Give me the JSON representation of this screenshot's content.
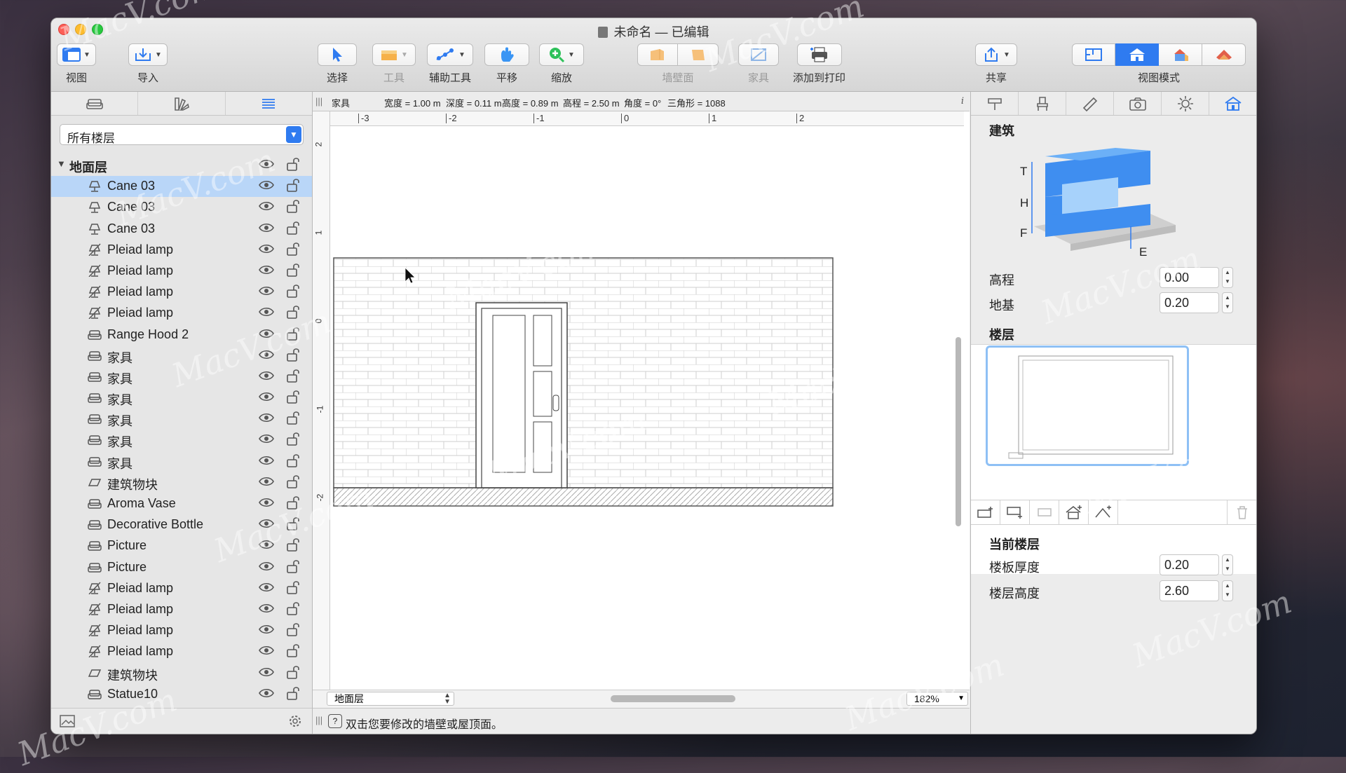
{
  "window": {
    "title": "未命名 — 已编辑"
  },
  "toolbar": {
    "view_label": "视图",
    "import_label": "导入",
    "select_label": "选择",
    "tools_label": "工具",
    "helper_tools_label": "辅助工具",
    "pan_label": "平移",
    "zoom_label": "缩放",
    "wall_surface_label": "墙壁面",
    "furniture_label": "家具",
    "add_to_print_label": "添加到打印",
    "share_label": "共享",
    "view_mode_label": "视图模式"
  },
  "left_panel": {
    "floor_filter": "所有楼层",
    "group": {
      "name": "地面层"
    },
    "items": [
      {
        "name": "Cane 03",
        "icon": "lamp-icon",
        "selected": true
      },
      {
        "name": "Cane 03",
        "icon": "lamp-icon",
        "selected": false
      },
      {
        "name": "Cane 03",
        "icon": "lamp-icon",
        "selected": false
      },
      {
        "name": "Pleiad lamp",
        "icon": "lamp-hidden-icon",
        "selected": false
      },
      {
        "name": "Pleiad lamp",
        "icon": "lamp-hidden-icon",
        "selected": false
      },
      {
        "name": "Pleiad lamp",
        "icon": "lamp-hidden-icon",
        "selected": false
      },
      {
        "name": "Pleiad lamp",
        "icon": "lamp-hidden-icon",
        "selected": false
      },
      {
        "name": "Range Hood 2",
        "icon": "furniture-icon",
        "selected": false
      },
      {
        "name": "家具",
        "icon": "furniture-icon",
        "selected": false
      },
      {
        "name": "家具",
        "icon": "furniture-icon",
        "selected": false
      },
      {
        "name": "家具",
        "icon": "furniture-icon",
        "selected": false
      },
      {
        "name": "家具",
        "icon": "furniture-icon",
        "selected": false
      },
      {
        "name": "家具",
        "icon": "furniture-icon",
        "selected": false
      },
      {
        "name": "家具",
        "icon": "furniture-icon",
        "selected": false
      },
      {
        "name": "建筑物块",
        "icon": "block-icon",
        "selected": false
      },
      {
        "name": "Aroma Vase",
        "icon": "furniture-icon",
        "selected": false
      },
      {
        "name": "Decorative Bottle",
        "icon": "furniture-icon",
        "selected": false
      },
      {
        "name": "Picture",
        "icon": "furniture-icon",
        "selected": false
      },
      {
        "name": "Picture",
        "icon": "furniture-icon",
        "selected": false
      },
      {
        "name": "Pleiad lamp",
        "icon": "lamp-hidden-icon",
        "selected": false
      },
      {
        "name": "Pleiad lamp",
        "icon": "lamp-hidden-icon",
        "selected": false
      },
      {
        "name": "Pleiad lamp",
        "icon": "lamp-hidden-icon",
        "selected": false
      },
      {
        "name": "Pleiad lamp",
        "icon": "lamp-hidden-icon",
        "selected": false
      },
      {
        "name": "建筑物块",
        "icon": "block-icon",
        "selected": false
      },
      {
        "name": "Statue10",
        "icon": "furniture-icon",
        "selected": false
      }
    ]
  },
  "infobar": {
    "category": "家具",
    "width": "宽度 = 1.00 m",
    "depth": "深度 = 0.11 m",
    "height": "高度 = 0.89 m",
    "elevation": "高程 = 2.50 m",
    "angle": "角度 = 0°",
    "triangles": "三角形 = 1088",
    "info_icon": "i"
  },
  "rulers": {
    "unit": "m",
    "top_ticks": [
      "-3",
      "-2",
      "-1",
      "0",
      "1",
      "2"
    ],
    "left_ticks": [
      "2",
      "1",
      "0",
      "-1",
      "-2"
    ]
  },
  "canvas_footer": {
    "floor": "地面层",
    "zoom": "182%"
  },
  "status": {
    "text": "双击您要修改的墙壁或屋顶面。",
    "help": "?"
  },
  "right_panel": {
    "building_title": "建筑",
    "diagram_labels": {
      "T": "T",
      "H": "H",
      "F": "F",
      "E": "E"
    },
    "elevation_label": "高程",
    "elevation_value": "0.00",
    "foundation_label": "地基",
    "foundation_value": "0.20",
    "floors_title": "楼层",
    "current_floor_title": "当前楼层",
    "slab_label": "楼板厚度",
    "slab_value": "0.20",
    "floor_height_label": "楼层高度",
    "floor_height_value": "2.60"
  },
  "watermark": "MacV.com",
  "colors": {
    "accent": "#2f7bf0",
    "selection": "#b9d6f8",
    "building_blue": "#3f8ef0"
  }
}
